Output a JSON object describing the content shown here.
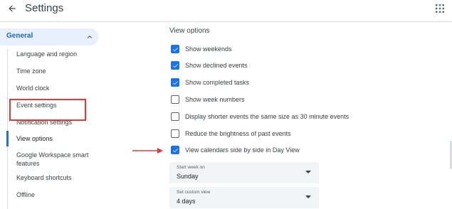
{
  "header": {
    "title": "Settings",
    "back_icon": "arrow-back-icon",
    "apps_icon": "apps-grid-icon"
  },
  "sidebar": {
    "section_label": "General",
    "section_icon": "chevron-up-icon",
    "items": [
      {
        "label": "Language and region"
      },
      {
        "label": "Time zone"
      },
      {
        "label": "World clock"
      },
      {
        "label": "Event settings"
      },
      {
        "label": "Notification settings"
      },
      {
        "label": "View options",
        "active": true
      },
      {
        "label": "Google Workspace smart features"
      },
      {
        "label": "Keyboard shortcuts"
      },
      {
        "label": "Offline"
      }
    ]
  },
  "main": {
    "section_title": "View options",
    "checkboxes": [
      {
        "label": "Show weekends",
        "checked": true
      },
      {
        "label": "Show declined events",
        "checked": true
      },
      {
        "label": "Show completed tasks",
        "checked": true
      },
      {
        "label": "Show week numbers",
        "checked": false
      },
      {
        "label": "Display shorter events the same size as 30 minute events",
        "checked": false
      },
      {
        "label": "Reduce the brightness of past events",
        "checked": false
      },
      {
        "label": "View calendars side by side in Day View",
        "checked": true
      }
    ],
    "selects": [
      {
        "label": "Start week on",
        "value": "Sunday"
      },
      {
        "label": "Set custom view",
        "value": "4 days"
      }
    ]
  },
  "colors": {
    "accent": "#1a73e8",
    "active_bg": "#e8f0fe",
    "annotation_red": "#e53935"
  }
}
